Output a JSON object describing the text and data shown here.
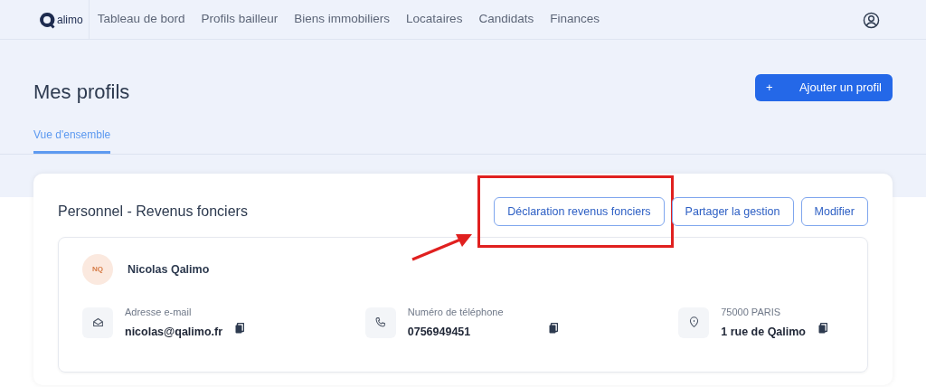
{
  "nav": {
    "logo_text": "alimo",
    "items": [
      {
        "label": "Tableau de bord",
        "selected": false
      },
      {
        "label": "Profils bailleur",
        "selected": false
      },
      {
        "label": "Biens immobiliers",
        "selected": false
      },
      {
        "label": "Locataires",
        "selected": false
      },
      {
        "label": "Candidats",
        "selected": false
      },
      {
        "label": "Finances",
        "selected": false
      }
    ]
  },
  "page": {
    "title": "Mes profils",
    "add_button": {
      "icon": "+",
      "label": "Ajouter un profil"
    },
    "tabs": [
      {
        "label": "Vue d'ensemble",
        "selected": true
      }
    ]
  },
  "profile_card": {
    "title": "Personnel - Revenus fonciers",
    "actions": [
      {
        "label": "Déclaration revenus fonciers",
        "highlighted": true
      },
      {
        "label": "Partager la gestion",
        "highlighted": false
      },
      {
        "label": "Modifier",
        "highlighted": false
      }
    ],
    "person": {
      "initials": "NQ",
      "name": "Nicolas Qalimo"
    },
    "contacts": [
      {
        "kind": "email",
        "label": "Adresse e-mail",
        "value": "nicolas@qalimo.fr"
      },
      {
        "kind": "phone",
        "label": "Numéro de téléphone",
        "value": "0756949451"
      },
      {
        "kind": "address",
        "label": "75000 PARIS",
        "value": "1 rue de Qalimo"
      }
    ]
  }
}
